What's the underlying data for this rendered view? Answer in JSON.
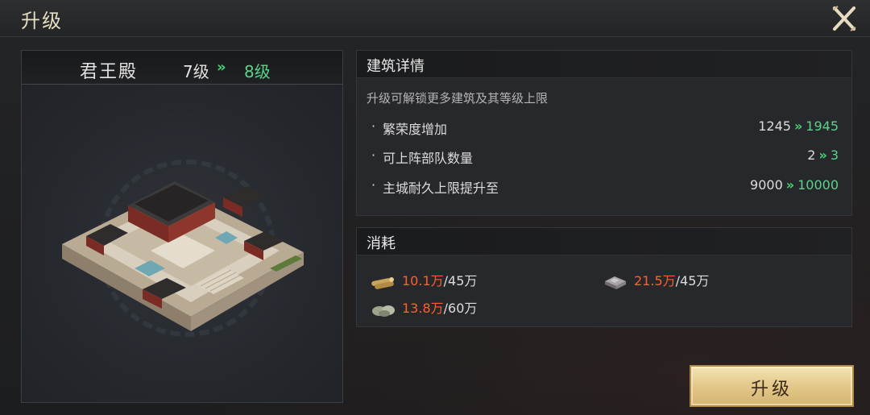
{
  "header": {
    "title": "升级",
    "close_icon": "close-x-icon"
  },
  "building": {
    "name": "君王殿",
    "level_from": "7级",
    "level_arrow": "»",
    "level_to": "8级",
    "image_icon": "palace-building-icon"
  },
  "details": {
    "title": "建筑详情",
    "description": "升级可解锁更多建筑及其等级上限",
    "rows": [
      {
        "bullet": "·",
        "label": "繁荣度增加",
        "from": "1245",
        "arrow": "»",
        "to": "1945"
      },
      {
        "bullet": "·",
        "label": "可上阵部队数量",
        "from": "2",
        "arrow": "»",
        "to": "3"
      },
      {
        "bullet": "·",
        "label": "主城耐久上限提升至",
        "from": "9000",
        "arrow": "»",
        "to": "10000"
      }
    ]
  },
  "cost": {
    "title": "消耗",
    "resources": [
      {
        "icon": "wood-icon",
        "current": "10.1万",
        "total": "/45万"
      },
      {
        "icon": "iron-icon",
        "current": "21.5万",
        "total": "/45万"
      },
      {
        "icon": "stone-icon",
        "current": "13.8万",
        "total": "/60万"
      }
    ]
  },
  "actions": {
    "upgrade_label": "升级"
  },
  "colors": {
    "increase": "#5bd38a",
    "insufficient": "#ff5f2e",
    "button": "#e3c88b"
  }
}
